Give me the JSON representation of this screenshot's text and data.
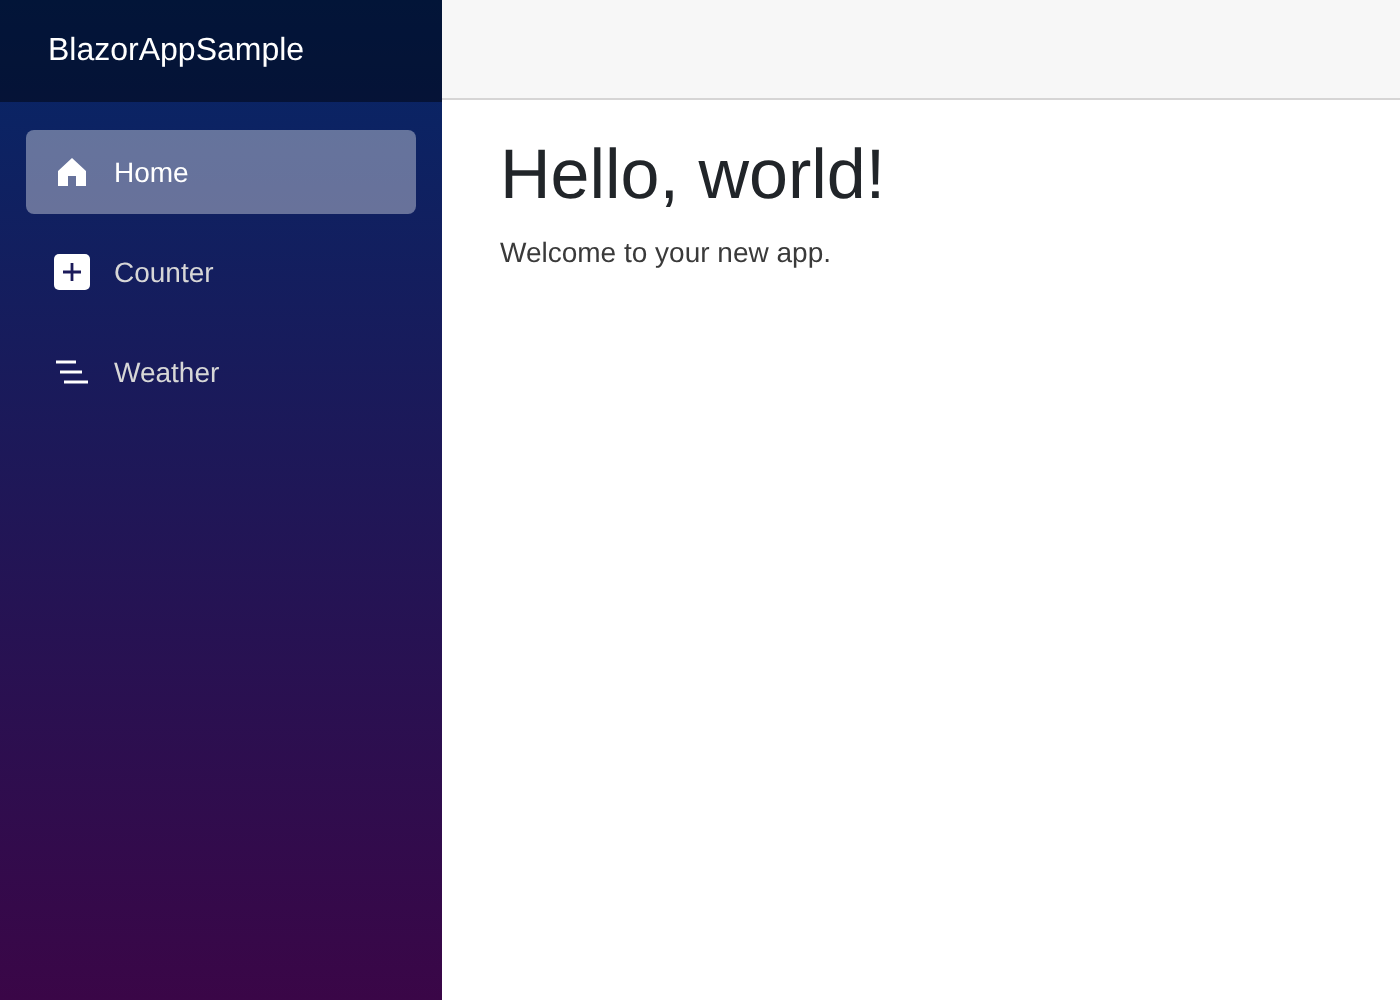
{
  "brand": "BlazorAppSample",
  "nav": [
    {
      "kind": "home",
      "label": "Home",
      "selected": true
    },
    {
      "kind": "plus",
      "label": "Counter",
      "selected": false
    },
    {
      "kind": "list",
      "label": "Weather",
      "selected": false
    }
  ],
  "heading": "Hello, world!",
  "text": "Welcome to your new app."
}
